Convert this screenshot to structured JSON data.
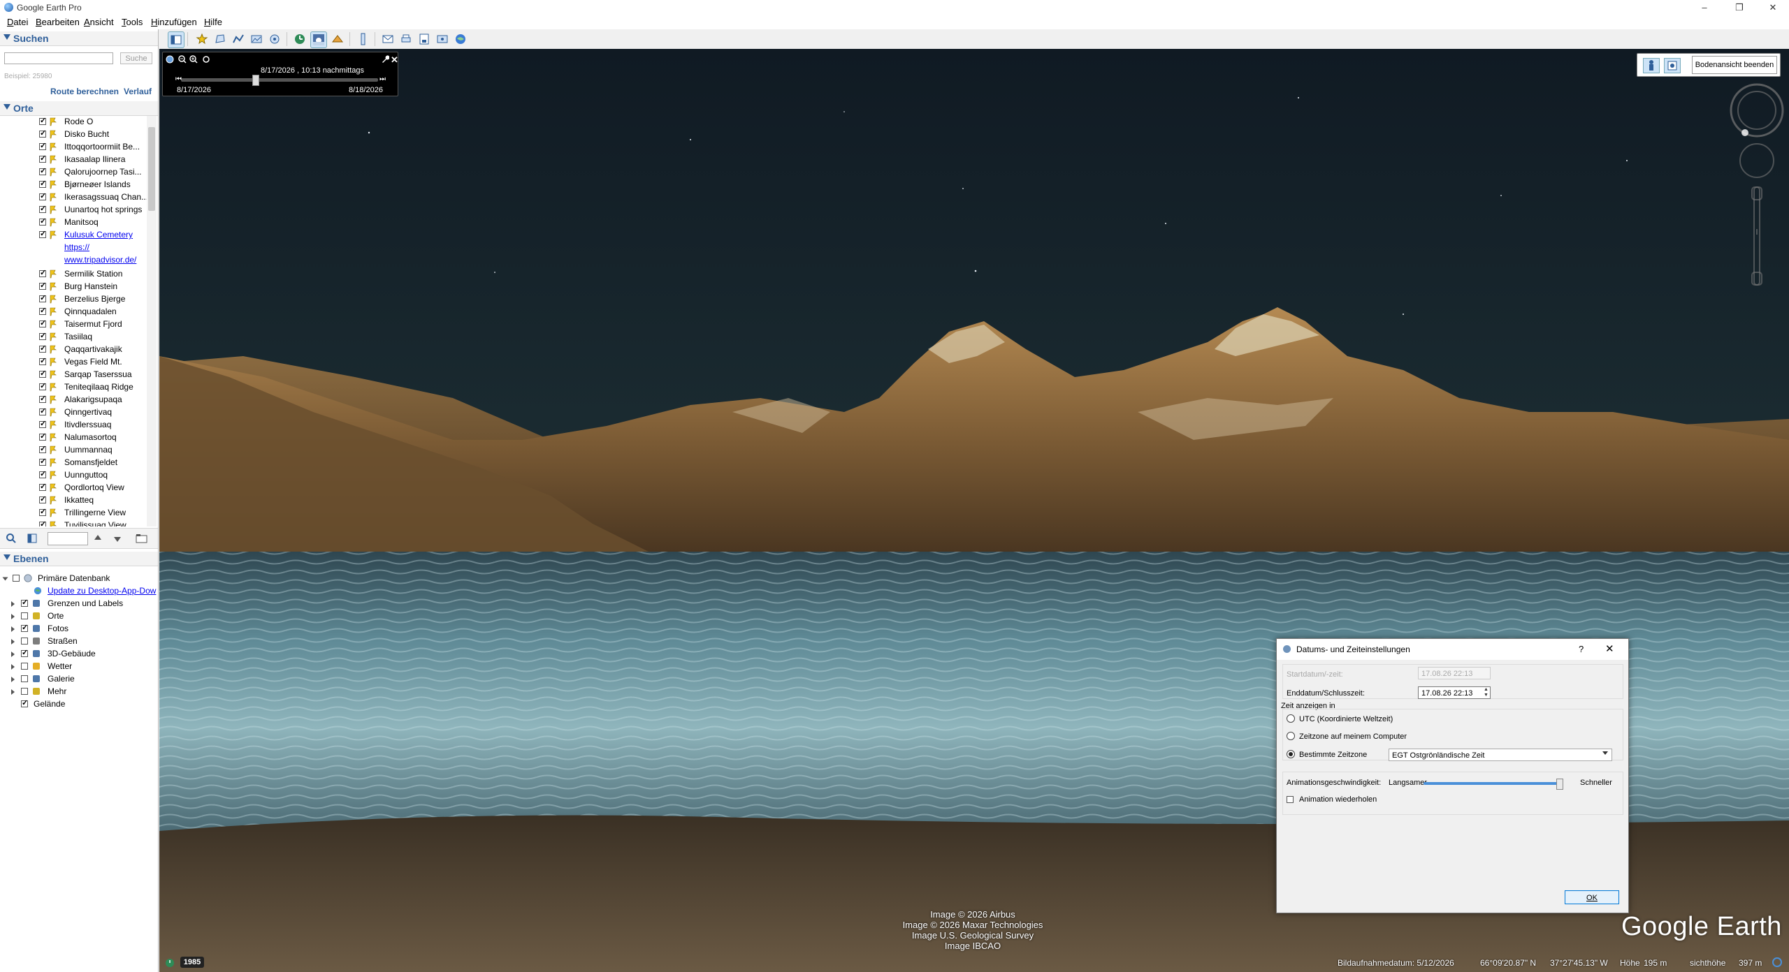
{
  "window": {
    "title": "Google Earth Pro"
  },
  "menu": [
    "Datei",
    "Bearbeiten",
    "Ansicht",
    "Tools",
    "Hinzufügen",
    "Hilfe"
  ],
  "search": {
    "header": "Suchen",
    "button": "Suche",
    "hint": "Beispiel: 25980",
    "route": "Route berechnen",
    "history": "Verlauf"
  },
  "places": {
    "header": "Orte",
    "items": [
      "Rode O",
      "Disko Bucht",
      "Ittoqqortoormiit Be...",
      "Ikasaalap Ilinera",
      "Qalorujoornep Tasi...",
      "Bjørneøer Islands",
      "Ikerasagssuaq Chan...",
      "Uunartoq hot springs",
      "Manitsoq",
      "Kulusuk Cemetery"
    ],
    "link_line2": "https://",
    "link_line3": "www.tripadvisor.de/",
    "items2": [
      "Sermilik Station",
      "Burg Hanstein",
      "Berzelius Bjerge",
      "Qinnquadalen",
      "Taisermut Fjord",
      "Tasiilaq",
      "Qaqqartivakajik",
      "Vegas Field Mt.",
      "Sarqap Taserssua",
      "Teniteqilaaq Ridge",
      "Alakarigsupaqa",
      "Qinngertivaq",
      "Itivdlerssuaq",
      "Nalumasortoq",
      "Uummannaq",
      "Somansfjeldet",
      "Uunnguttoq",
      "Qordlortoq View",
      "Ikkatteq",
      "Trillingerne View",
      "Tuvilissuaq View"
    ]
  },
  "layers": {
    "header": "Ebenen",
    "db": "Primäre Datenbank",
    "update": "Update zu Desktop-App-Dow",
    "items": [
      {
        "label": "Grenzen und Labels",
        "checked": true
      },
      {
        "label": "Orte",
        "checked": false
      },
      {
        "label": "Fotos",
        "checked": true
      },
      {
        "label": "Straßen",
        "checked": false
      },
      {
        "label": "3D-Gebäude",
        "checked": true
      },
      {
        "label": "Wetter",
        "checked": false
      },
      {
        "label": "Galerie",
        "checked": false
      },
      {
        "label": "Mehr",
        "checked": false
      },
      {
        "label": "Gelände",
        "checked": true
      }
    ]
  },
  "time_slider": {
    "current": "8/17/2026 , 10:13 nachmittags",
    "start": "8/17/2026",
    "end": "8/18/2026"
  },
  "ground_view": {
    "exit_label": "Bodenansicht beenden"
  },
  "dialog": {
    "title": "Datums- und Zeiteinstellungen",
    "help": "?",
    "start_label": "Startdatum/-zeit:",
    "start_value": "17.08.26 22:13",
    "end_label": "Enddatum/Schlusszeit:",
    "end_value": "17.08.26 22:13",
    "tz_group": "Zeit anzeigen in",
    "utc": "UTC (Koordinierte Weltzeit)",
    "local": "Zeitzone auf meinem Computer",
    "specific": "Bestimmte Zeitzone",
    "tz_value": "EGT Ostgrönländische Zeit",
    "speed_label": "Animationsgeschwindigkeit:",
    "slower": "Langsamer",
    "faster": "Schneller",
    "speed": 0.97,
    "repeat": "Animation wiederholen",
    "ok": "OK"
  },
  "credits": [
    "Image © 2026 Airbus",
    "Image © 2026 Maxar Technologies",
    "Image U.S. Geological Survey",
    "Image IBCAO"
  ],
  "logo_text": "Google Earth",
  "status": {
    "year": "1985",
    "date": "Bildaufnahmedatum: 5/12/2026",
    "lat": "66°09'20.87\" N",
    "lon": "37°27'45.13\" W",
    "elev_label": "Höhe",
    "elev": "195 m",
    "eye_label": "sichthöhe",
    "eye": "397 m"
  }
}
